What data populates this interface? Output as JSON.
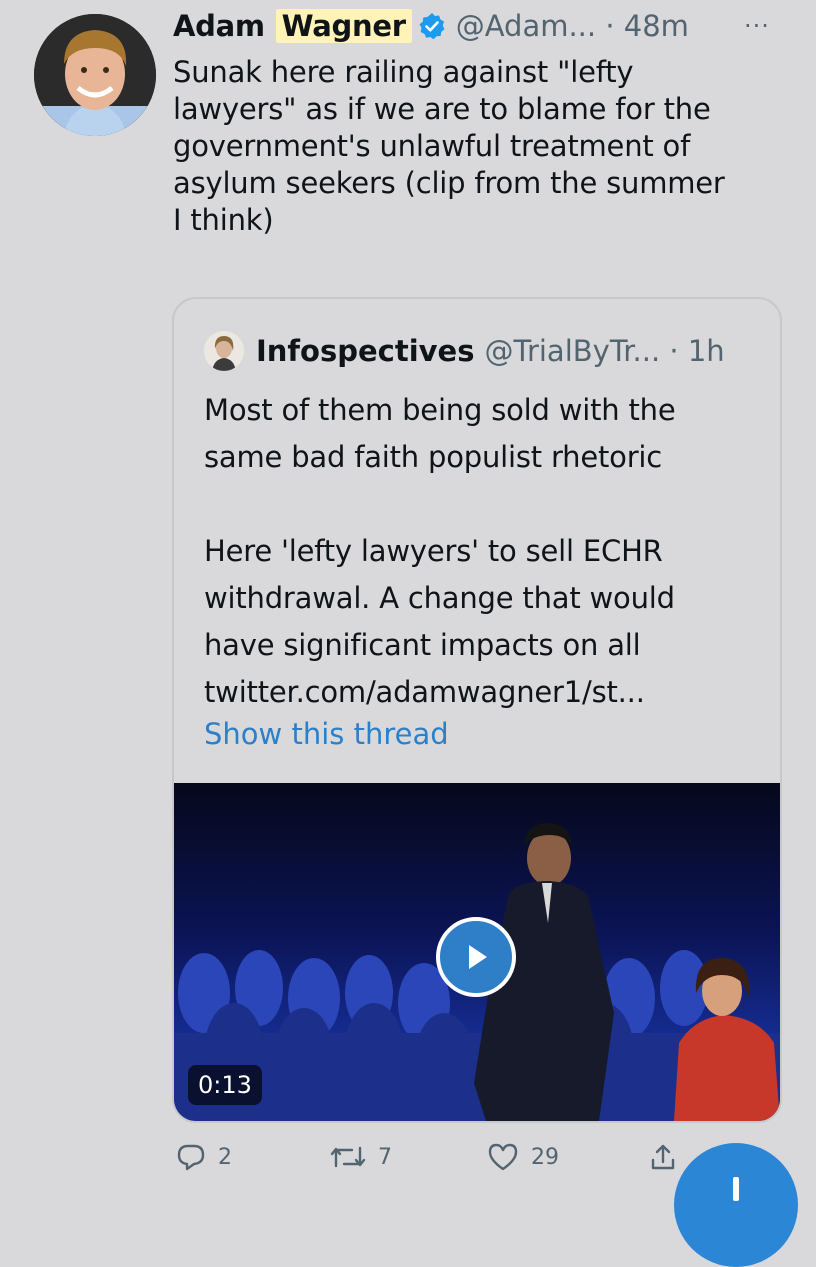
{
  "tweet": {
    "author_first": "Adam",
    "author_last": "Wagner",
    "handle": "@Adam...",
    "time": "· 48m",
    "more_label": "···",
    "text": "Sunak here railing against \"lefty\nlawyers\" as if we are to blame for the\ngovernment's unlawful treatment of\nasylum seekers (clip from the summer\nI think)"
  },
  "quote": {
    "author": "Infospectives",
    "handle": "@TrialByTr...",
    "time": "· 1h",
    "text": "Most of them being sold with the\nsame bad faith populist rhetoric\n\nHere 'lefty lawyers' to sell ECHR\nwithdrawal. A change that would\nhave significant impacts on all\ntwitter.com/adamwagner1/st...",
    "show_thread": "Show this thread",
    "video_duration": "0:13"
  },
  "actions": {
    "replies": "2",
    "retweets": "7",
    "likes": "29"
  },
  "icons": {
    "verified": "verified-badge-icon",
    "more": "more-options-icon",
    "play": "play-icon",
    "reply": "reply-icon",
    "retweet": "retweet-icon",
    "like": "heart-icon",
    "share": "share-icon",
    "compose": "compose-plus-icon"
  },
  "colors": {
    "background": "#d9d9dc",
    "link": "#2c7fc9",
    "verified": "#1d9bf0",
    "highlight": "#fff3b8",
    "fab": "#2c86d6"
  }
}
